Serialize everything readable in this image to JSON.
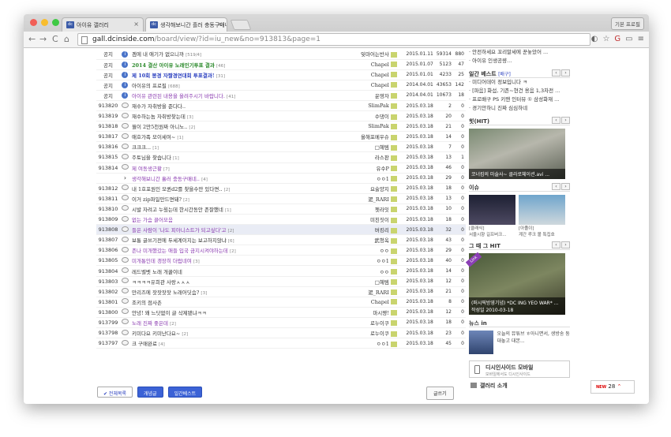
{
  "browser": {
    "tabs": [
      {
        "favicon": "dc",
        "title": "아이유 갤러리"
      },
      {
        "favicon": "dc",
        "title": "생각해보니간 흘러 충동구매네 ㅋ"
      }
    ],
    "profile_label": "기본 프로필",
    "url_domain": "gall.dcinside.com",
    "url_path": "/board/view/?id=iu_new&no=913813&page=1"
  },
  "board": {
    "rows": [
      {
        "num": "공지",
        "icon": "notice",
        "subject": "겜에 내 애기가 없으니까",
        "count": "[519/4]",
        "style": "ser",
        "name": "잊마어는반사",
        "date": "2015.01.11",
        "hits": "59314",
        "rec": "880"
      },
      {
        "num": "공지",
        "icon": "notice",
        "subject": "2014 결산 아이유 노래인기투표 결과",
        "count": "[46]",
        "style": "greenbold",
        "name": "Chapel",
        "date": "2015.01.07",
        "hits": "5123",
        "rec": "47"
      },
      {
        "num": "공지",
        "icon": "notice",
        "subject": "제 10회 봉경 자짤경연대회 투표결과!",
        "count": "[31]",
        "style": "bluebold",
        "name": "Chapel",
        "date": "2015.01.01",
        "hits": "4233",
        "rec": "25"
      },
      {
        "num": "공지",
        "icon": "notice",
        "subject": "아이유의 프로필",
        "count": "[688]",
        "style": "ser",
        "name": "Chapel",
        "date": "2014.04.01",
        "hits": "43653",
        "rec": "142"
      },
      {
        "num": "공지",
        "icon": "notice",
        "subject": "아이유 관련된 내용을 올려주시기 바랍니다.",
        "count": "[41]",
        "style": "purple",
        "name": "운영자",
        "date": "2014.04.01",
        "hits": "10673",
        "rec": "18"
      },
      {
        "num": "913820",
        "icon": "bubble",
        "subject": "재수가 자취방을 준다다..",
        "count": "",
        "style": "ser",
        "name": "SlimPak",
        "date": "2015.03.18",
        "hits": "2",
        "rec": "0"
      },
      {
        "num": "913819",
        "icon": "bubble",
        "subject": "재수하는놈 자취방찾는데",
        "count": "[3]",
        "style": "ser",
        "name": "수댕이",
        "date": "2015.03.18",
        "hits": "20",
        "rec": "0"
      },
      {
        "num": "913818",
        "icon": "bubble",
        "subject": "뭘이 2만5천원짜 아니노..",
        "count": "[2]",
        "style": "ser",
        "name": "SlimPak",
        "date": "2015.03.18",
        "hits": "21",
        "rec": "0"
      },
      {
        "num": "913817",
        "icon": "bubble",
        "subject": "애호가족 모이세여~",
        "count": "[1]",
        "style": "ser",
        "name": "올해포메우슈",
        "date": "2015.03.18",
        "hits": "14",
        "rec": "0"
      },
      {
        "num": "913816",
        "icon": "bubble",
        "subject": "크크크...",
        "count": "[1]",
        "style": "ser",
        "name": "□혜템",
        "date": "2015.03.18",
        "hits": "7",
        "rec": "0"
      },
      {
        "num": "913815",
        "icon": "bubble",
        "subject": "주토님을 찾습니다",
        "count": "[1]",
        "style": "ser",
        "name": "라스판",
        "date": "2015.03.18",
        "hits": "13",
        "rec": "1"
      },
      {
        "num": "913814",
        "icon": "bubble",
        "subject": "제 여동생근황",
        "count": "[7]",
        "style": "purple",
        "name": "유수P",
        "date": "2015.03.18",
        "hits": "46",
        "rec": "0"
      },
      {
        "num": "",
        "icon": "arrow",
        "subject": "생각해보니간 흘러 충동구매네..",
        "count": "[4]",
        "style": "purple",
        "name": "ㅇㅇ1",
        "date": "2015.03.18",
        "hits": "29",
        "rec": "0"
      },
      {
        "num": "913812",
        "icon": "bubble",
        "subject": "내 1호포원인 모퀸d2를 찾을수만 있다면..",
        "count": "[2]",
        "style": "ser",
        "name": "요술양지",
        "date": "2015.03.18",
        "hits": "18",
        "rec": "0"
      },
      {
        "num": "913811",
        "icon": "bubble",
        "subject": "이거 zip파일만드면돼?",
        "count": "[2]",
        "style": "ser",
        "name": "泥_RARI",
        "date": "2015.03.18",
        "hits": "13",
        "rec": "0"
      },
      {
        "num": "913810",
        "icon": "bubble",
        "subject": "시발 자려고 누웠는데 한시간동안 존잘했네",
        "count": "[1]",
        "style": "ser",
        "name": "젯라잇",
        "date": "2015.03.18",
        "hits": "10",
        "rec": "0"
      },
      {
        "num": "913809",
        "icon": "bubble",
        "subject": "없는 가슴 끌어모음",
        "count": "",
        "style": "purple",
        "name": "미친짓이",
        "date": "2015.03.18",
        "hits": "18",
        "rec": "0"
      },
      {
        "num": "913808",
        "icon": "bubble",
        "subject": "들은 사람이 '나도 피아니스트가 되고싶다'고",
        "count": "[2]",
        "style": "purple",
        "name": "버킹리",
        "date": "2015.03.18",
        "hits": "32",
        "rec": "0"
      },
      {
        "num": "913807",
        "icon": "bubble",
        "subject": "보통 글쓰기전에 두세계이지는 보고하지않냐",
        "count": "[6]",
        "style": "ser",
        "name": "武청옥",
        "date": "2015.03.18",
        "hits": "43",
        "rec": "0"
      },
      {
        "num": "913806",
        "icon": "bubble",
        "subject": "존나 미개했갔는 애들 입국 금지시켜야하는데",
        "count": "[2]",
        "style": "purple",
        "name": "ㅇㅇ",
        "date": "2015.03.18",
        "hits": "29",
        "rec": "0"
      },
      {
        "num": "913805",
        "icon": "bubble",
        "subject": "미개통인데 갱장히 더럽네여",
        "count": "[3]",
        "style": "purple",
        "name": "ㅇㅇ1",
        "date": "2015.03.18",
        "hits": "40",
        "rec": "0"
      },
      {
        "num": "913804",
        "icon": "bubble",
        "subject": "레드벨벳 노래 개꿀이네",
        "count": "",
        "style": "ser",
        "name": "ㅇㅇ",
        "date": "2015.03.18",
        "hits": "14",
        "rec": "0"
      },
      {
        "num": "913803",
        "icon": "bubble",
        "subject": "ㅋㅋㅋㅋ유희관 사랑ㅅㅅㅅ",
        "count": "",
        "style": "ser",
        "name": "□혜템",
        "date": "2015.03.18",
        "hits": "12",
        "rec": "0"
      },
      {
        "num": "913802",
        "icon": "bubble",
        "subject": "만리즈에 잣잣잣잣 노래어딧슴?",
        "count": "[3]",
        "style": "ser",
        "name": "泥_RARI",
        "date": "2015.03.18",
        "hits": "21",
        "rec": "0"
      },
      {
        "num": "913801",
        "icon": "bubble",
        "subject": "조키의 점사촌",
        "count": "",
        "style": "ser",
        "name": "Chapel",
        "date": "2015.03.18",
        "hits": "8",
        "rec": "0"
      },
      {
        "num": "913800",
        "icon": "bubble",
        "subject": "안녕! 왜 느닷없이 글 삭제됐냐ㅋㅋ",
        "count": "",
        "style": "ser",
        "name": "마시쨩!",
        "date": "2015.03.18",
        "hits": "12",
        "rec": "0"
      },
      {
        "num": "913799",
        "icon": "bubble",
        "subject": "노래 진짜 좋은데",
        "count": "[2]",
        "style": "purple",
        "name": "로누이쿠",
        "date": "2015.03.18",
        "hits": "18",
        "rec": "0"
      },
      {
        "num": "913798",
        "icon": "bubble",
        "subject": "키미다요 키미난다요~",
        "count": "[2]",
        "style": "ser",
        "name": "로누이쿠",
        "date": "2015.03.18",
        "hits": "23",
        "rec": "0"
      },
      {
        "num": "913797",
        "icon": "bubble",
        "subject": "크 구매완료",
        "count": "[4]",
        "style": "ser",
        "name": "ㅇㅇ1",
        "date": "2015.03.18",
        "hits": "45",
        "rec": "0"
      }
    ],
    "buttons": {
      "all": "✔ 전체목록",
      "concept": "개념글",
      "ilgan": "일간베스트",
      "write": "글쓰기"
    },
    "pager": {
      "pages": [
        "1",
        "2",
        "3",
        "4",
        "5",
        "6",
        "7",
        "8",
        "9",
        "10"
      ],
      "current": "1",
      "next": "다음›",
      "end": "맨뒤»"
    }
  },
  "sidebar": {
    "top_lines": [
      "· 안전하세요 꼬리말세에 꾼놓았어 ...",
      "· 아이유 인생공량..."
    ],
    "ilgan": {
      "title": "일간 베스트",
      "sub": "[배구]",
      "items": [
        "· 미디어데이 정보입니다 ㅋ",
        "· [파음] 화섭, 기존~현건 용음 1,3차전 ...",
        "· 프로배구 PS 키맨 인터뷰 ① 삼성화재 ...",
        "· 경기안하니 진짜 심심하네"
      ]
    },
    "hit": {
      "title": "힛(HIT)",
      "caption": "코너킴의 마술사~ 클라로체이션.avi ..."
    },
    "issue": {
      "title": "이슈",
      "captions": [
        [
          "[클래식]",
          "[아졸이]"
        ],
        [
          "서울시향 길프버크...",
          "계간 루크 볼 특집호"
        ]
      ]
    },
    "ghit": {
      "title": "그 때 그 HIT",
      "ribbon": "Link",
      "caption": "(퍼시픽방영기념) *DC ING YEO WAR* ...",
      "date": "작성일 2010-03-18"
    },
    "news": {
      "title": "뉴스 in",
      "text": "오늘의 뮤튜브 ㅎ아니면서, 생방송 둥 대놓고 대본..."
    },
    "mobile": {
      "title": "디시인사이드 모바일",
      "sub": "모바일에서도 디시인사이드"
    },
    "intro": "갤러리 소개"
  },
  "float": {
    "new_label": "NEW",
    "count": "28"
  }
}
